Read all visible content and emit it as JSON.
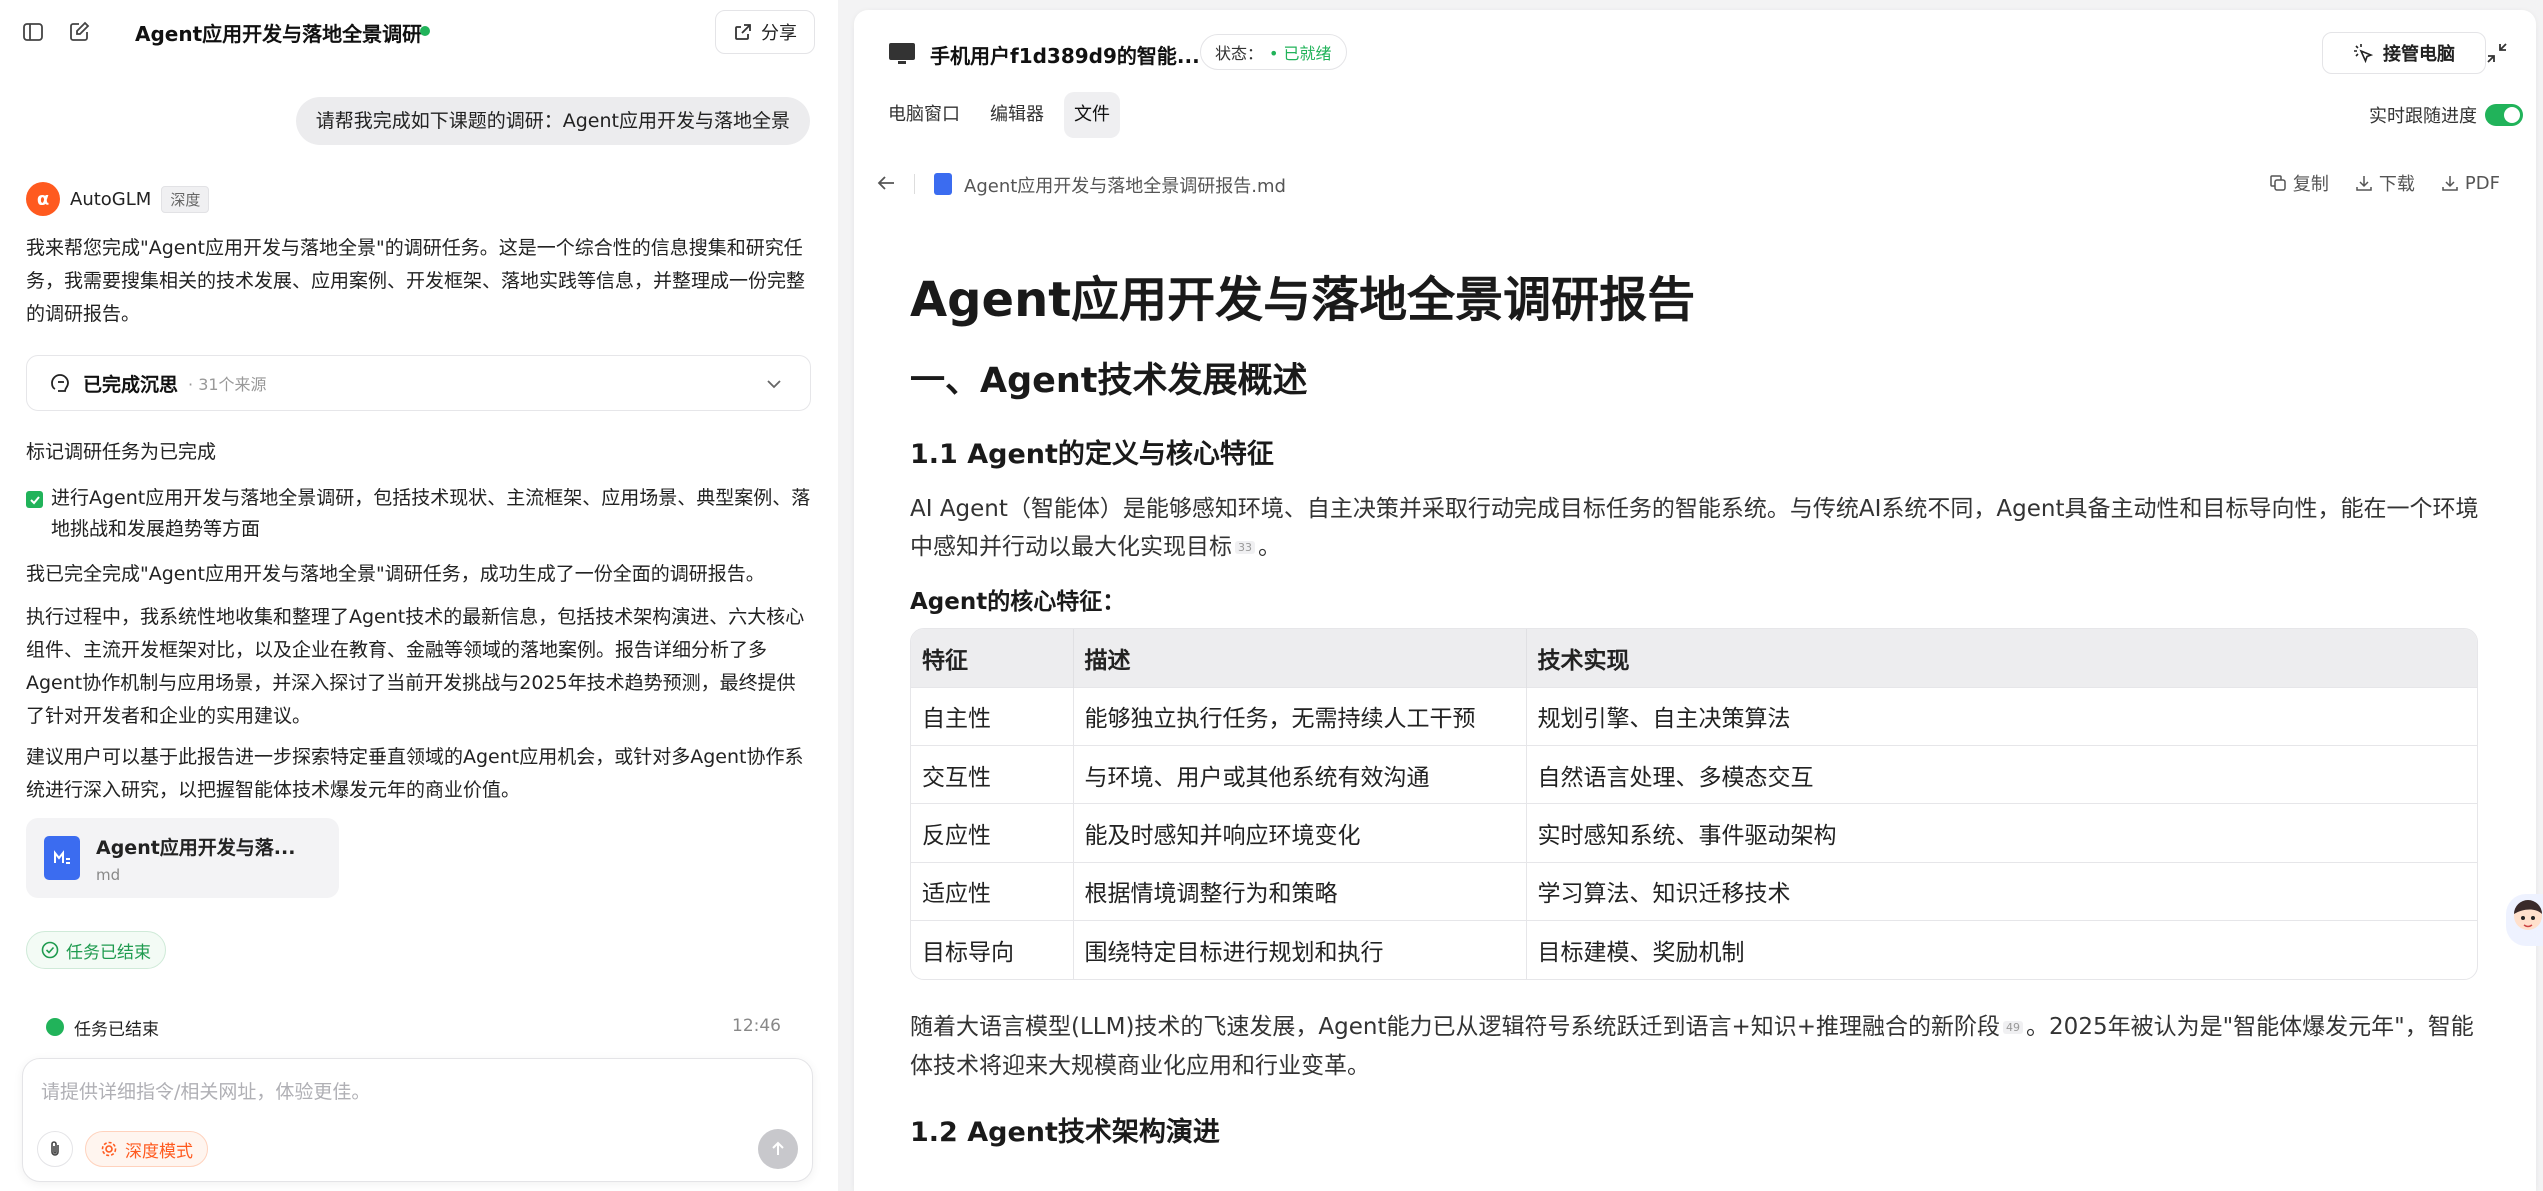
{
  "left": {
    "title": "Agent应用开发与落地全景调研",
    "share_label": "分享",
    "user_message": "请帮我完成如下课题的调研：Agent应用开发与落地全景",
    "agent": {
      "name": "AutoGLM",
      "badge": "深度"
    },
    "intro": "我来帮您完成\"Agent应用开发与落地全景\"的调研任务。这是一个综合性的信息搜集和研究任务，我需要搜集相关的技术发展、应用案例、开发框架、落地实践等信息，并整理成一份完整的调研报告。",
    "think": {
      "title": "已完成沉思",
      "sources": "· 31个来源"
    },
    "mark_done": "标记调研任务为已完成",
    "check_item": "进行Agent应用开发与落地全景调研，包括技术现状、主流框架、应用场景、典型案例、落地挑战和发展趋势等方面",
    "done_summary": "我已完全完成\"Agent应用开发与落地全景\"调研任务，成功生成了一份全面的调研报告。",
    "process": "执行过程中，我系统性地收集和整理了Agent技术的最新信息，包括技术架构演进、六大核心组件、主流开发框架对比，以及企业在教育、金融等领域的落地案例。报告详细分析了多Agent协作机制与应用场景，并深入探讨了当前开发挑战与2025年技术趋势预测，最终提供了针对开发者和企业的实用建议。",
    "suggestion": "建议用户可以基于此报告进一步探索特定垂直领域的Agent应用机会，或针对多Agent协作系统进行深入研究，以把握智能体技术爆发元年的商业价值。",
    "file": {
      "name": "Agent应用开发与落...",
      "ext": "md"
    },
    "task_done_pill": "任务已结束",
    "status_line": {
      "label": "任务已结束",
      "time": "12:46"
    },
    "input": {
      "placeholder": "请提供详细指令/相关网址，体验更佳。",
      "deep_mode": "深度模式"
    }
  },
  "right": {
    "device_title": "手机用户f1d389d9的智能...",
    "status_label": "状态：",
    "status_value": "已就绪",
    "takeover": "接管电脑",
    "tabs": [
      "电脑窗口",
      "编辑器",
      "文件"
    ],
    "active_tab": 2,
    "follow_label": "实时跟随进度",
    "follow_on": true,
    "file_name": "Agent应用开发与落地全景调研报告.md",
    "actions": {
      "copy": "复制",
      "download": "下载",
      "pdf": "PDF"
    },
    "doc": {
      "h1": "Agent应用开发与落地全景调研报告",
      "h2": "一、Agent技术发展概述",
      "h3a": "1.1 Agent的定义与核心特征",
      "p1": "AI Agent（智能体）是能够感知环境、自主决策并采取行动完成目标任务的智能系统。与传统AI系统不同，Agent具备主动性和目标导向性，能在一个环境中感知并行动以最大化实现目标",
      "p1_ref": "33",
      "p1_end": "。",
      "key_features": "Agent的核心特征：",
      "table": {
        "headers": [
          "特征",
          "描述",
          "技术实现"
        ],
        "rows": [
          [
            "自主性",
            "能够独立执行任务，无需持续人工干预",
            "规划引擎、自主决策算法"
          ],
          [
            "交互性",
            "与环境、用户或其他系统有效沟通",
            "自然语言处理、多模态交互"
          ],
          [
            "反应性",
            "能及时感知并响应环境变化",
            "实时感知系统、事件驱动架构"
          ],
          [
            "适应性",
            "根据情境调整行为和策略",
            "学习算法、知识迁移技术"
          ],
          [
            "目标导向",
            "围绕特定目标进行规划和执行",
            "目标建模、奖励机制"
          ]
        ]
      },
      "p2a": "随着大语言模型(LLM)技术的飞速发展，Agent能力已从逻辑符号系统跃迁到语言+知识+推理融合的新阶段",
      "p2_ref": "49",
      "p2b": "。2025年被认为是\"智能体爆发元年\"，智能体技术将迎来大规模商业化应用和行业变革。",
      "h3b": "1.2 Agent技术架构演进"
    }
  }
}
